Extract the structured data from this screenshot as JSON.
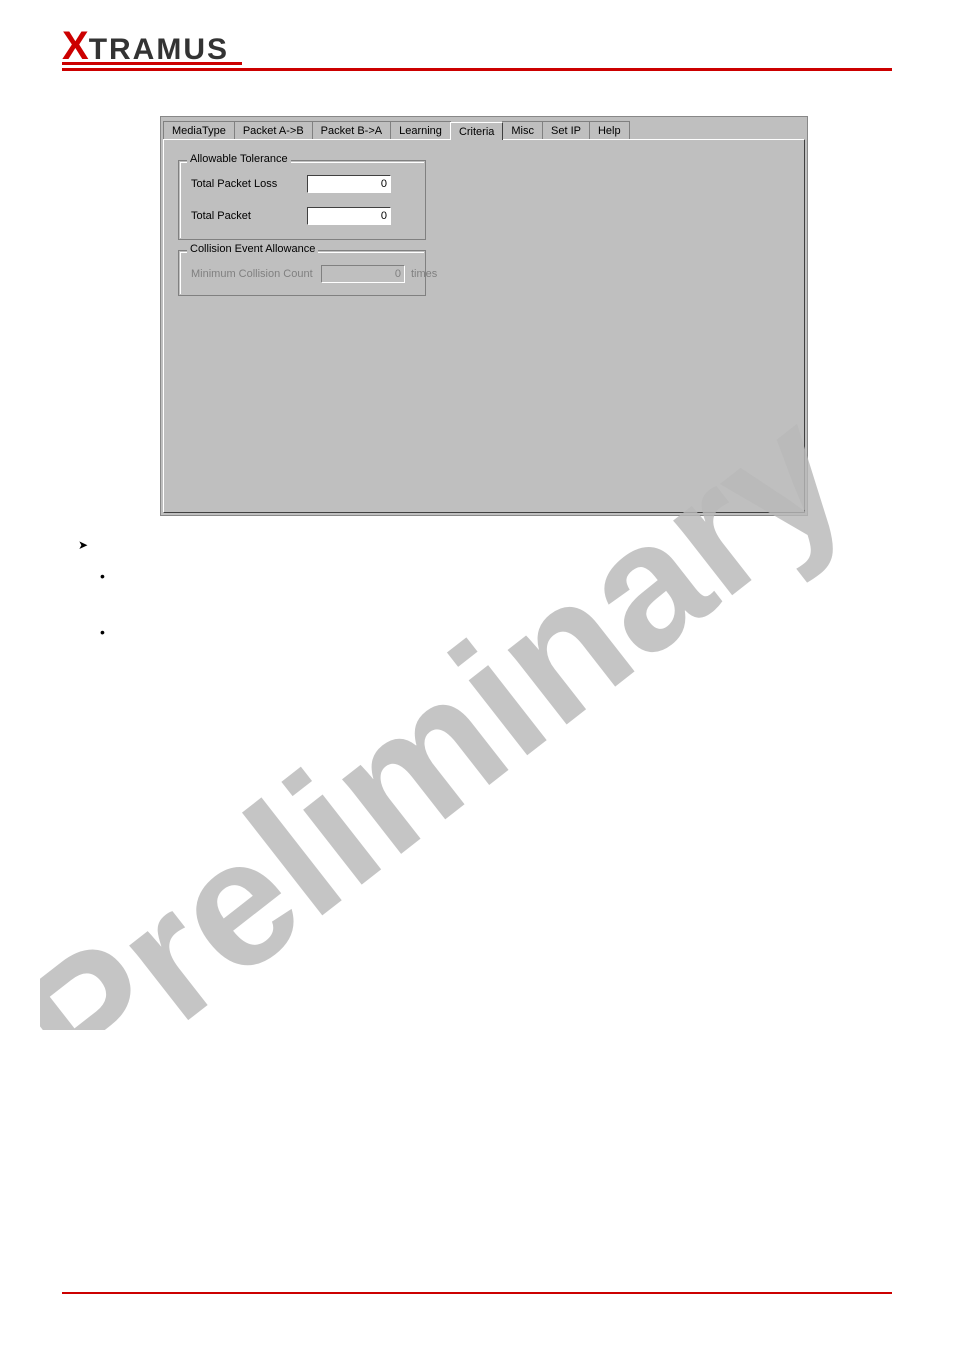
{
  "brand": {
    "x": "X",
    "rest": "TRAMUS"
  },
  "tabs": {
    "items": [
      {
        "label": "MediaType"
      },
      {
        "label": "Packet A->B"
      },
      {
        "label": "Packet B->A"
      },
      {
        "label": "Learning"
      },
      {
        "label": "Criteria"
      },
      {
        "label": "Misc"
      },
      {
        "label": "Set IP"
      },
      {
        "label": "Help"
      }
    ],
    "activeIndex": 4
  },
  "allowable": {
    "legend": "Allowable Tolerance",
    "loss_label": "Total Packet Loss",
    "loss_value": "0",
    "packet_label": "Total Packet",
    "packet_value": "0"
  },
  "collision": {
    "legend": "Collision Event Allowance",
    "min_label": "Minimum Collision Count",
    "min_value": "0",
    "unit": "times"
  },
  "watermark_text": "Preliminary"
}
